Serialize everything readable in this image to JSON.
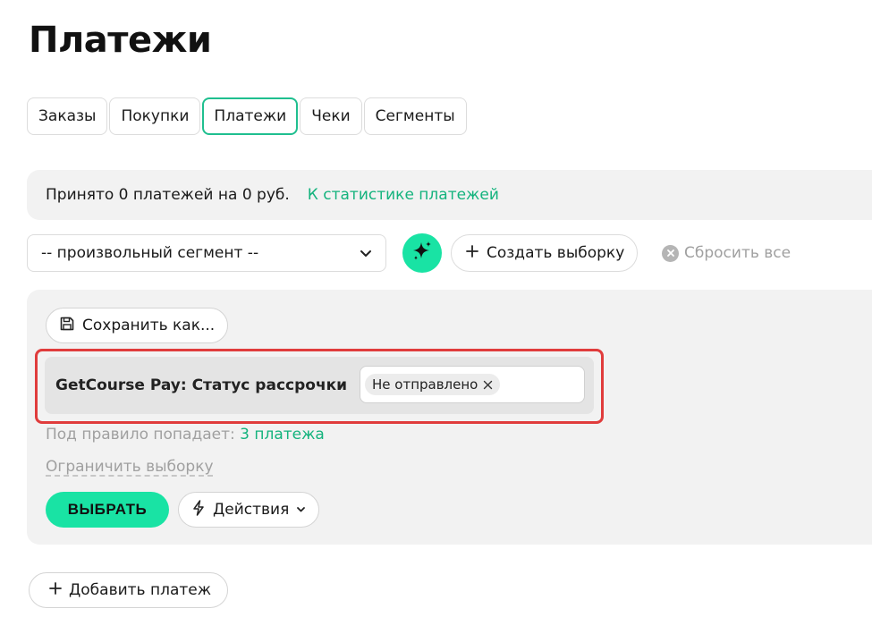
{
  "page": {
    "title": "Платежи"
  },
  "tabs": [
    {
      "label": "Заказы",
      "active": false
    },
    {
      "label": "Покупки",
      "active": false
    },
    {
      "label": "Платежи",
      "active": true
    },
    {
      "label": "Чеки",
      "active": false
    },
    {
      "label": "Сегменты",
      "active": false
    }
  ],
  "stats": {
    "summary": "Принято 0 платежей на 0 руб.",
    "link_label": "К статистике платежей"
  },
  "toolbar": {
    "segment_value": "-- произвольный сегмент --",
    "create_label": "Создать выборку",
    "reset_label": "Сбросить все"
  },
  "filter": {
    "save_as_label": "Сохранить как...",
    "condition_label": "GetCourse Pay: Статус рассрочки",
    "condition_chip": "Не отправлено",
    "rule_count_prefix": "Под правило попадает:",
    "rule_count_link": "3 платежа",
    "limit_label": "Ограничить выборку",
    "select_label": "ВЫБРАТЬ",
    "actions_label": "Действия"
  },
  "footer": {
    "add_payment_label": "Добавить платеж"
  },
  "colors": {
    "accent": "#19e3a4",
    "link": "#14b37d",
    "highlight_border": "#e03c3c",
    "panel_bg": "#f2f2f2"
  },
  "icons": {
    "segment_chevron": "chevron-down-icon",
    "ai": "sparkle-icon",
    "create": "plus-icon",
    "reset": "close-circle-icon",
    "save": "floppy-disk-icon",
    "chip_remove": "close-icon",
    "actions": "lightning-icon",
    "actions_chevron": "chevron-down-icon",
    "add_payment": "plus-icon"
  }
}
